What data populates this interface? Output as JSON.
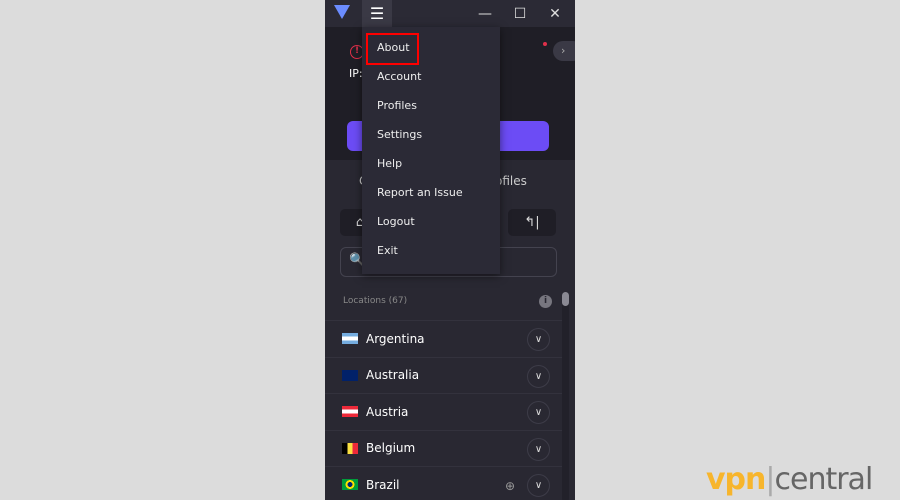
{
  "titlebar": {
    "minimize": "—",
    "maximize": "☐",
    "close": "✕",
    "menu_icon": "☰"
  },
  "header": {
    "warning": "!",
    "ip_label": "IP:",
    "arrow": "›"
  },
  "tabs": {
    "partial_left": "C",
    "partial_right": "ofiles"
  },
  "toolbar": {
    "right_icon": "↰|",
    "left_icon": "⌂"
  },
  "search": {
    "icon": "🔍"
  },
  "locations": {
    "header": "Locations (67)",
    "info": "i",
    "items": [
      {
        "name": "Argentina",
        "flag": "ar"
      },
      {
        "name": "Australia",
        "flag": "au"
      },
      {
        "name": "Austria",
        "flag": "at"
      },
      {
        "name": "Belgium",
        "flag": "be"
      },
      {
        "name": "Brazil",
        "flag": "br",
        "globe": true
      }
    ]
  },
  "menu": {
    "items": [
      "About",
      "Account",
      "Profiles",
      "Settings",
      "Help",
      "Report an Issue",
      "Logout",
      "Exit"
    ],
    "highlighted": "About",
    "highlight_color": "#ff0000"
  },
  "watermark": {
    "part1": "vpn",
    "part2": "central"
  },
  "colors": {
    "accent": "#6c4cf5",
    "warning": "#e0304a"
  }
}
